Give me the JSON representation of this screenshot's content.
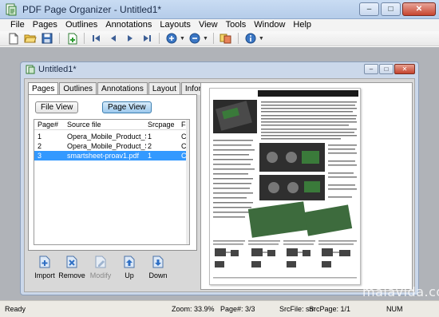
{
  "app": {
    "title": "PDF Page Organizer - Untitled1*"
  },
  "window_buttons": {
    "minimize": "–",
    "maximize": "□",
    "close": "✕"
  },
  "menu": [
    "File",
    "Pages",
    "Outlines",
    "Annotations",
    "Layouts",
    "View",
    "Tools",
    "Window",
    "Help"
  ],
  "toolbar": {
    "icons": [
      "new-document-icon",
      "open-folder-icon",
      "save-icon",
      "add-page-icon",
      "first-page-icon",
      "previous-page-icon",
      "next-page-icon",
      "last-page-icon",
      "zoom-in-icon",
      "zoom-out-icon",
      "merge-icon",
      "info-icon"
    ]
  },
  "child_window": {
    "title": "Untitled1*"
  },
  "tabs": [
    "Pages",
    "Outlines",
    "Annotations",
    "Layout",
    "Information"
  ],
  "active_tab": "Pages",
  "view_buttons": {
    "file_view": "File View",
    "page_view": "Page View"
  },
  "grid": {
    "columns": [
      "Page#",
      "Source file",
      "Srcpage",
      "Fo"
    ],
    "rows": [
      {
        "page": "1",
        "source": "Opera_Mobile_Product_S...",
        "srcpage": "1",
        "fo": "C:\\"
      },
      {
        "page": "2",
        "source": "Opera_Mobile_Product_S...",
        "srcpage": "2",
        "fo": "C:\\"
      },
      {
        "page": "3",
        "source": "smartsheet-proav1.pdf",
        "srcpage": "1",
        "fo": "C:\\"
      }
    ],
    "selected_row": 3
  },
  "actions": [
    {
      "label": "Import",
      "icon": "import-icon",
      "enabled": true
    },
    {
      "label": "Remove",
      "icon": "remove-icon",
      "enabled": true
    },
    {
      "label": "Modify",
      "icon": "modify-icon",
      "enabled": false
    },
    {
      "label": "Up",
      "icon": "up-icon",
      "enabled": true
    },
    {
      "label": "Down",
      "icon": "down-icon",
      "enabled": true
    }
  ],
  "status": {
    "ready": "Ready",
    "zoom": "Zoom: 33.9%",
    "page": "Page#: 3/3",
    "srcfile": "SrcFile: sm",
    "srcpage": "SrcPage: 1/1",
    "num": "NUM"
  },
  "watermark": "malavida.com",
  "colors": {
    "selection": "#3399ff",
    "titlebar": "#c9dcf3",
    "mdi_background": "#b0b3b8"
  }
}
